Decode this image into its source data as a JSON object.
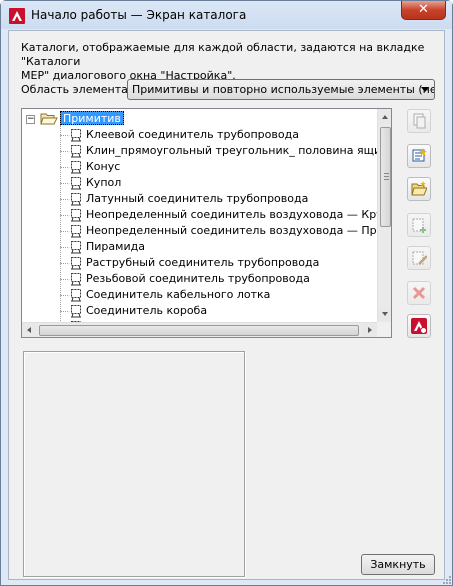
{
  "window": {
    "title": "Начало работы — Экран каталога",
    "close_glyph": "✕"
  },
  "description": "Каталоги, отображаемые для каждой области, задаются на вкладке \"Каталоги\nMEP\" диалогового окна \"Настройка\".",
  "area": {
    "label": "Область элемента:",
    "selected": "Примитивы и повторно используемые элементы (не осн"
  },
  "tree": {
    "expander": "−",
    "root_label": "Примитив",
    "items": [
      {
        "label": "Клеевой соединитель трубопровода"
      },
      {
        "label": "Клин_прямоугольный треугольник_ половина ящика"
      },
      {
        "label": "Конус"
      },
      {
        "label": "Купол"
      },
      {
        "label": "Латунный соединитель трубопровода"
      },
      {
        "label": "Неопределенный соединитель воздуховода — Круглое"
      },
      {
        "label": "Неопределенный соединитель воздуховода — Прямоуго"
      },
      {
        "label": "Пирамида"
      },
      {
        "label": "Раструбный соединитель трубопровода"
      },
      {
        "label": "Резьбовой соединитель трубопровода"
      },
      {
        "label": "Соединитель кабельного лотка"
      },
      {
        "label": "Соединитель короба"
      },
      {
        "label": ""
      }
    ]
  },
  "toolbar": {
    "buttons": [
      {
        "icon": "copy-catalog-icon",
        "enabled": false
      },
      {
        "icon": "new-catalog-icon",
        "enabled": true
      },
      {
        "icon": "open-folder-icon",
        "enabled": true
      },
      {
        "icon": "add-part-icon",
        "enabled": false
      },
      {
        "icon": "edit-part-icon",
        "enabled": false
      },
      {
        "icon": "delete-icon",
        "enabled": false
      },
      {
        "icon": "autocad-mep-icon",
        "enabled": true
      }
    ]
  },
  "buttons": {
    "close_label": "Замкнуть"
  },
  "colors": {
    "selection": "#3399ff",
    "delete_red": "#e0524a",
    "autocad_red": "#c8102e"
  }
}
